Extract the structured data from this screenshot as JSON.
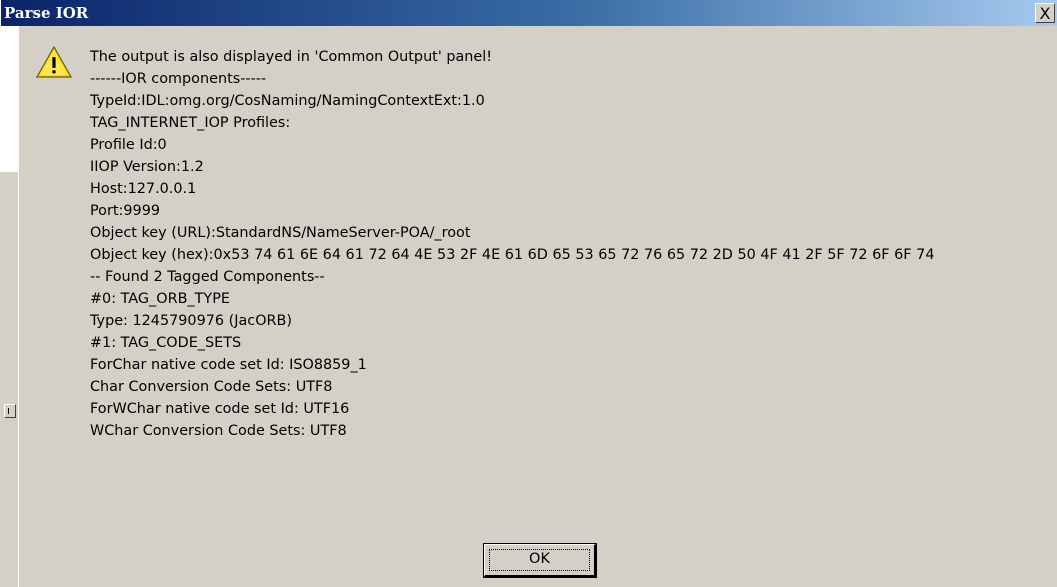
{
  "window": {
    "title": "Parse IOR",
    "close_glyph": "X"
  },
  "icons": {
    "warning": "warning-triangle-icon",
    "close": "close-icon"
  },
  "colors": {
    "title_bar_start": "#0a246a",
    "title_bar_end": "#a6caf0",
    "dialog_bg": "#d4d0c8",
    "warning_yellow": "#ffd700"
  },
  "message": {
    "lines": [
      "The output is also displayed in 'Common Output' panel!",
      "------IOR components-----",
      "TypeId:IDL:omg.org/CosNaming/NamingContextExt:1.0",
      "TAG_INTERNET_IOP Profiles:",
      "Profile Id:0",
      "IIOP Version:1.2",
      "Host:127.0.0.1",
      "Port:9999",
      "Object key (URL):StandardNS/NameServer-POA/_root",
      "Object key (hex):0x53 74 61 6E 64 61 72 64 4E 53 2F 4E 61 6D 65 53 65 72 76 65 72 2D 50 4F 41 2F 5F 72 6F 6F 74",
      "-- Found 2 Tagged Components--",
      "#0: TAG_ORB_TYPE",
      "Type: 1245790976 (JacORB)",
      "#1: TAG_CODE_SETS",
      "ForChar native code set Id: ISO8859_1",
      "Char Conversion Code Sets: UTF8",
      "ForWChar native code set Id: UTF16",
      "WChar Conversion Code Sets: UTF8"
    ]
  },
  "buttons": {
    "ok_label": "OK"
  }
}
